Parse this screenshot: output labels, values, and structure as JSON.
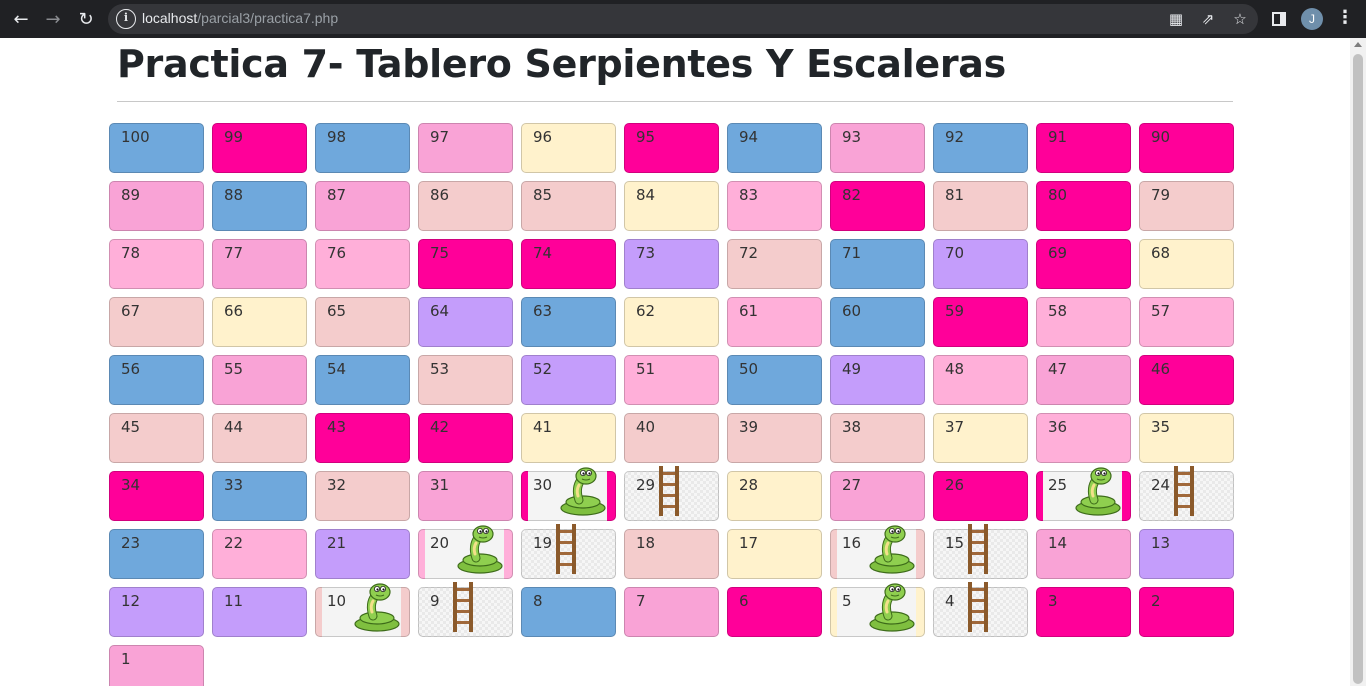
{
  "browser": {
    "url_host": "localhost",
    "url_path": "/parcial3/practica7.php",
    "avatar_initial": "J"
  },
  "page": {
    "title": "Practica 7- Tablero Serpientes Y Escaleras"
  },
  "colors": {
    "blue": "#6fa8dc",
    "magenta": "#ff0099",
    "pink": "#f9a3d6",
    "lightpink": "#ffafd9",
    "cream": "#fff2cc",
    "rose": "#f4cccc",
    "lavender": "#c49dfb"
  },
  "board": {
    "rows": [
      [
        {
          "n": "100",
          "c": "blue"
        },
        {
          "n": "99",
          "c": "magenta"
        },
        {
          "n": "98",
          "c": "blue"
        },
        {
          "n": "97",
          "c": "pink"
        },
        {
          "n": "96",
          "c": "cream"
        },
        {
          "n": "95",
          "c": "magenta"
        },
        {
          "n": "94",
          "c": "blue"
        },
        {
          "n": "93",
          "c": "pink"
        },
        {
          "n": "92",
          "c": "blue"
        },
        {
          "n": "91",
          "c": "magenta"
        },
        {
          "n": "90",
          "c": "magenta"
        }
      ],
      [
        {
          "n": "89",
          "c": "pink"
        },
        {
          "n": "88",
          "c": "blue"
        },
        {
          "n": "87",
          "c": "pink"
        },
        {
          "n": "86",
          "c": "rose"
        },
        {
          "n": "85",
          "c": "rose"
        },
        {
          "n": "84",
          "c": "cream"
        },
        {
          "n": "83",
          "c": "lightpink"
        },
        {
          "n": "82",
          "c": "magenta"
        },
        {
          "n": "81",
          "c": "rose"
        },
        {
          "n": "80",
          "c": "magenta"
        },
        {
          "n": "79",
          "c": "rose"
        }
      ],
      [
        {
          "n": "78",
          "c": "lightpink"
        },
        {
          "n": "77",
          "c": "pink"
        },
        {
          "n": "76",
          "c": "lightpink"
        },
        {
          "n": "75",
          "c": "magenta"
        },
        {
          "n": "74",
          "c": "magenta"
        },
        {
          "n": "73",
          "c": "lavender"
        },
        {
          "n": "72",
          "c": "rose"
        },
        {
          "n": "71",
          "c": "blue"
        },
        {
          "n": "70",
          "c": "lavender"
        },
        {
          "n": "69",
          "c": "magenta"
        },
        {
          "n": "68",
          "c": "cream"
        }
      ],
      [
        {
          "n": "67",
          "c": "rose"
        },
        {
          "n": "66",
          "c": "cream"
        },
        {
          "n": "65",
          "c": "rose"
        },
        {
          "n": "64",
          "c": "lavender"
        },
        {
          "n": "63",
          "c": "blue"
        },
        {
          "n": "62",
          "c": "cream"
        },
        {
          "n": "61",
          "c": "lightpink"
        },
        {
          "n": "60",
          "c": "blue"
        },
        {
          "n": "59",
          "c": "magenta"
        },
        {
          "n": "58",
          "c": "lightpink"
        },
        {
          "n": "57",
          "c": "lightpink"
        }
      ],
      [
        {
          "n": "56",
          "c": "blue"
        },
        {
          "n": "55",
          "c": "pink"
        },
        {
          "n": "54",
          "c": "blue"
        },
        {
          "n": "53",
          "c": "rose"
        },
        {
          "n": "52",
          "c": "lavender"
        },
        {
          "n": "51",
          "c": "lightpink"
        },
        {
          "n": "50",
          "c": "blue"
        },
        {
          "n": "49",
          "c": "lavender"
        },
        {
          "n": "48",
          "c": "lightpink"
        },
        {
          "n": "47",
          "c": "pink"
        },
        {
          "n": "46",
          "c": "magenta"
        }
      ],
      [
        {
          "n": "45",
          "c": "rose"
        },
        {
          "n": "44",
          "c": "rose"
        },
        {
          "n": "43",
          "c": "magenta"
        },
        {
          "n": "42",
          "c": "magenta"
        },
        {
          "n": "41",
          "c": "cream"
        },
        {
          "n": "40",
          "c": "rose"
        },
        {
          "n": "39",
          "c": "rose"
        },
        {
          "n": "38",
          "c": "rose"
        },
        {
          "n": "37",
          "c": "cream"
        },
        {
          "n": "36",
          "c": "lightpink"
        },
        {
          "n": "35",
          "c": "cream"
        }
      ],
      [
        {
          "n": "34",
          "c": "magenta"
        },
        {
          "n": "33",
          "c": "blue"
        },
        {
          "n": "32",
          "c": "rose"
        },
        {
          "n": "31",
          "c": "pink"
        },
        {
          "n": "30",
          "c": "magenta",
          "icon": "snake"
        },
        {
          "n": "29",
          "c": "gray",
          "icon": "ladder"
        },
        {
          "n": "28",
          "c": "cream"
        },
        {
          "n": "27",
          "c": "pink"
        },
        {
          "n": "26",
          "c": "magenta"
        },
        {
          "n": "25",
          "c": "magenta",
          "icon": "snake"
        },
        {
          "n": "24",
          "c": "gray",
          "icon": "ladder"
        }
      ],
      [
        {
          "n": "23",
          "c": "blue"
        },
        {
          "n": "22",
          "c": "lightpink"
        },
        {
          "n": "21",
          "c": "lavender"
        },
        {
          "n": "20",
          "c": "lightpink",
          "icon": "snake"
        },
        {
          "n": "19",
          "c": "gray",
          "icon": "ladder"
        },
        {
          "n": "18",
          "c": "rose"
        },
        {
          "n": "17",
          "c": "cream"
        },
        {
          "n": "16",
          "c": "rose",
          "icon": "snake"
        },
        {
          "n": "15",
          "c": "gray",
          "icon": "ladder"
        },
        {
          "n": "14",
          "c": "pink"
        },
        {
          "n": "13",
          "c": "lavender"
        }
      ],
      [
        {
          "n": "12",
          "c": "lavender"
        },
        {
          "n": "11",
          "c": "lavender"
        },
        {
          "n": "10",
          "c": "rose",
          "icon": "snake"
        },
        {
          "n": "9",
          "c": "gray",
          "icon": "ladder"
        },
        {
          "n": "8",
          "c": "blue"
        },
        {
          "n": "7",
          "c": "pink"
        },
        {
          "n": "6",
          "c": "magenta"
        },
        {
          "n": "5",
          "c": "cream",
          "icon": "snake"
        },
        {
          "n": "4",
          "c": "gray",
          "icon": "ladder"
        },
        {
          "n": "3",
          "c": "magenta"
        },
        {
          "n": "2",
          "c": "magenta"
        }
      ],
      [
        {
          "n": "1",
          "c": "pink"
        }
      ]
    ]
  }
}
